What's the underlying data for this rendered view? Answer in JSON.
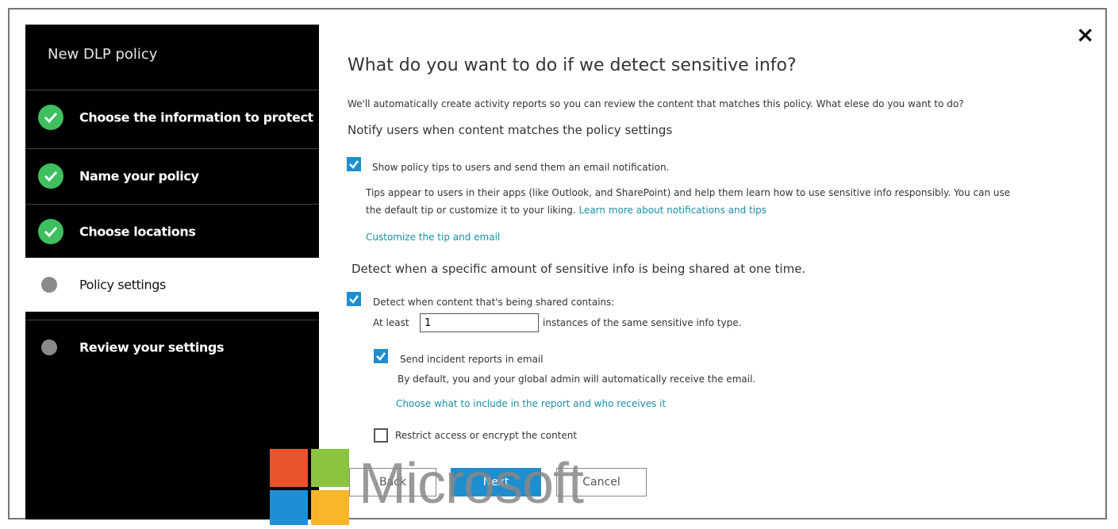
{
  "sidebar": {
    "title": "New DLP policy",
    "steps": [
      {
        "label": "Choose the information to protect",
        "status": "complete"
      },
      {
        "label": "Name your policy",
        "status": "complete"
      },
      {
        "label": "Choose locations",
        "status": "complete"
      },
      {
        "label": "Policy settings",
        "status": "current"
      },
      {
        "label": "Review your settings",
        "status": "pending"
      }
    ]
  },
  "colors": {
    "sidebar_bg": "#000000",
    "check_green": "#3fbf5f",
    "accent_blue": "#1f8ecf",
    "link": "#1a8fa8"
  },
  "main": {
    "heading": "What do you want to do if we detect sensitive info?",
    "intro": "We'll automatically create activity reports so you can review the content that matches this policy. What elese do you want to do?",
    "notify_heading": "Notify users when content matches the policy settings",
    "policy_tips": {
      "label": "Show policy tips to users and send them an email notification.",
      "checked": true,
      "description_line1": "Tips appear to users in their apps (like Outlook, and SharePoint) and help them learn how to use sensitive info responsibly. You can use",
      "description_line2": "the default tip or customize it to your liking.",
      "learn_more_link": "Learn more about notifications and tips",
      "customize_link": "Customize the tip and email"
    },
    "detect_heading": "Detect when a specific amount of sensitive info is being shared at one time.",
    "detect": {
      "label": "Detect when content that's being shared contains:",
      "checked": true,
      "at_least_label": "At least",
      "instances_value": "1",
      "instances_suffix": "instances of the same sensitive info type."
    },
    "incident_reports": {
      "label": "Send incident reports in email",
      "checked": true,
      "description": "By default, you and your global admin will automatically receive the email.",
      "choose_link": "Choose what to include in the report and who receives it"
    },
    "restrict": {
      "label": "Restrict access or encrypt the content",
      "checked": false
    }
  },
  "buttons": {
    "back": "Back",
    "next": "Next",
    "cancel": "Cancel"
  },
  "close_icon": "×",
  "watermark": {
    "logo_text": "Microsoft"
  }
}
